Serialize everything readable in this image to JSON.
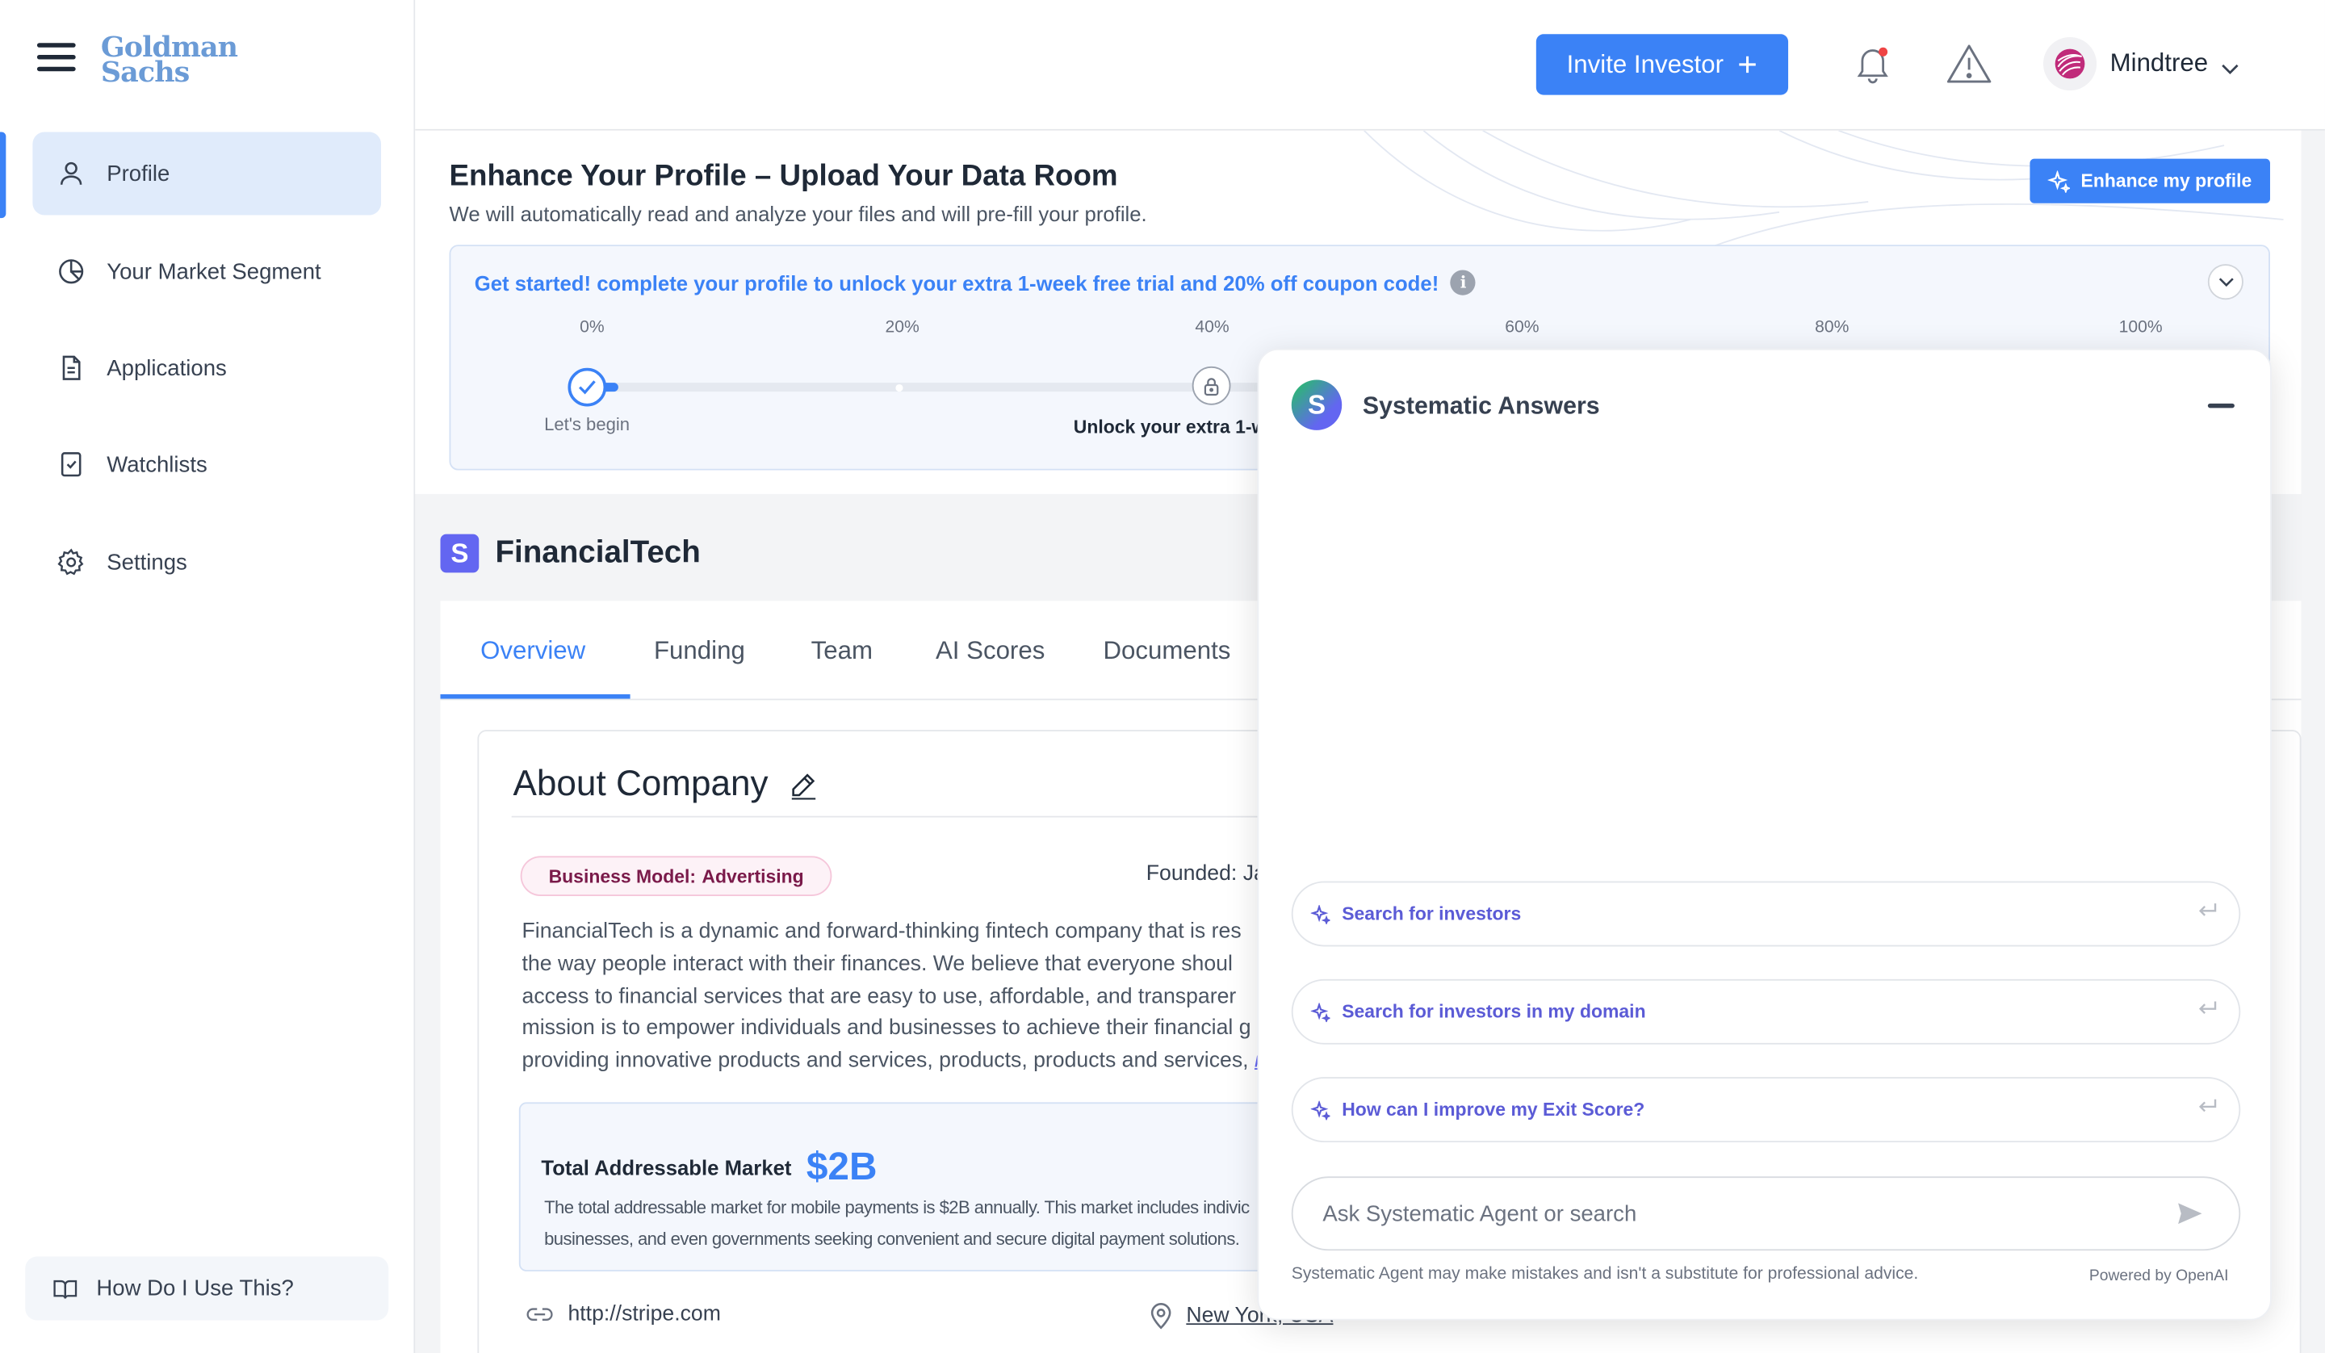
{
  "logo": {
    "line1": "Goldman",
    "line2": "Sachs"
  },
  "sidebar": {
    "items": [
      {
        "label": "Profile",
        "icon": "user-icon",
        "active": true
      },
      {
        "label": "Your Market Segment",
        "icon": "pie-chart-icon"
      },
      {
        "label": "Applications",
        "icon": "document-icon"
      },
      {
        "label": "Watchlists",
        "icon": "bookmark-icon"
      },
      {
        "label": "Settings",
        "icon": "gear-icon"
      }
    ],
    "help_label": "How Do I Use This?"
  },
  "header": {
    "invite_label": "Invite Investor",
    "user_name": "Mindtree"
  },
  "enhance": {
    "title": "Enhance Your Profile – Upload Your Data Room",
    "subtitle": "We will automatically read and analyze your files and will pre-fill your profile.",
    "button_label": "Enhance my profile",
    "promo_text": "Get started! complete your profile to unlock your extra 1-week free trial and 20% off coupon code!",
    "percent_labels": [
      "0%",
      "20%",
      "40%",
      "60%",
      "80%",
      "100%"
    ],
    "progress": 0.03,
    "step_begin_label": "Let's begin",
    "step_unlock_label": "Unlock your extra 1-we"
  },
  "company": {
    "icon_letter": "S",
    "name": "FinancialTech",
    "tabs": [
      "Overview",
      "Funding",
      "Team",
      "AI Scores",
      "Documents"
    ],
    "active_tab": "Overview",
    "about_title": "About Company",
    "business_model_label": "Business Model:",
    "business_model_value": "Advertising",
    "founded_label": "Founded: Ja",
    "description_lines": [
      "FinancialTech is a dynamic and forward-thinking fintech company that is res",
      "the way people interact with their finances. We believe that everyone shoul",
      "access to financial services that are easy to use, affordable, and transparer",
      "mission is to empower individuals and businesses to achieve their financial g",
      "providing innovative products and services, products, products and services,"
    ],
    "description_more": "m",
    "tam_label": "Total Addressable Market",
    "tam_value": "$2B",
    "tam_desc_line1": "The total addressable market for mobile payments is $2B annually. This market includes indivic",
    "tam_desc_line2": "businesses, and even governments seeking convenient and secure digital payment solutions.",
    "website": "http://stripe.com",
    "location": "New York, USA"
  },
  "chat": {
    "logo_letter": "S",
    "title": "Systematic Answers",
    "suggestions": [
      "Search for investors",
      "Search for investors in my domain",
      "How can I improve my Exit Score?"
    ],
    "input_placeholder": "Ask Systematic Agent or search",
    "disclaimer": "Systematic Agent may make mistakes and isn't a substitute for professional advice.",
    "powered_by": "Powered by OpenAI"
  },
  "colors": {
    "accent": "#3b82f6",
    "brand_logo": "#6b9bd6",
    "company_icon": "#6366f1",
    "badge_text": "#7a1a4a"
  }
}
